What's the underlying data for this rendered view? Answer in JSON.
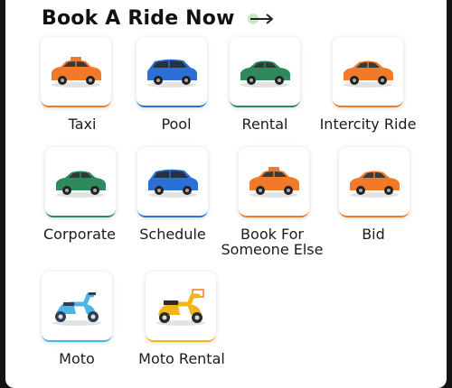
{
  "header": {
    "title": "Book A Ride Now"
  },
  "rides": [
    {
      "label": "Taxi",
      "icon": "taxi-car-icon",
      "accent": "#f07a2a"
    },
    {
      "label": "Pool",
      "icon": "blue-car-icon",
      "accent": "#2c6fd6"
    },
    {
      "label": "Rental",
      "icon": "green-car-icon",
      "accent": "#2e8a5b"
    },
    {
      "label": "Intercity Ride",
      "icon": "orange-car-icon",
      "accent": "#f07a2a"
    },
    {
      "label": "Corporate",
      "icon": "green-car-icon",
      "accent": "#2e8a5b"
    },
    {
      "label": "Schedule",
      "icon": "blue-car-icon",
      "accent": "#2c6fd6"
    },
    {
      "label": "Book For\nSomeone Else",
      "icon": "taxi-car-icon",
      "accent": "#f07a2a"
    },
    {
      "label": "Bid",
      "icon": "orange-car-icon",
      "accent": "#f07a2a"
    },
    {
      "label": "Moto",
      "icon": "blue-scooter-icon",
      "accent": "#4ab6e5"
    },
    {
      "label": "Moto Rental",
      "icon": "yellow-scooter-icon",
      "accent": "#f2b51c"
    }
  ]
}
